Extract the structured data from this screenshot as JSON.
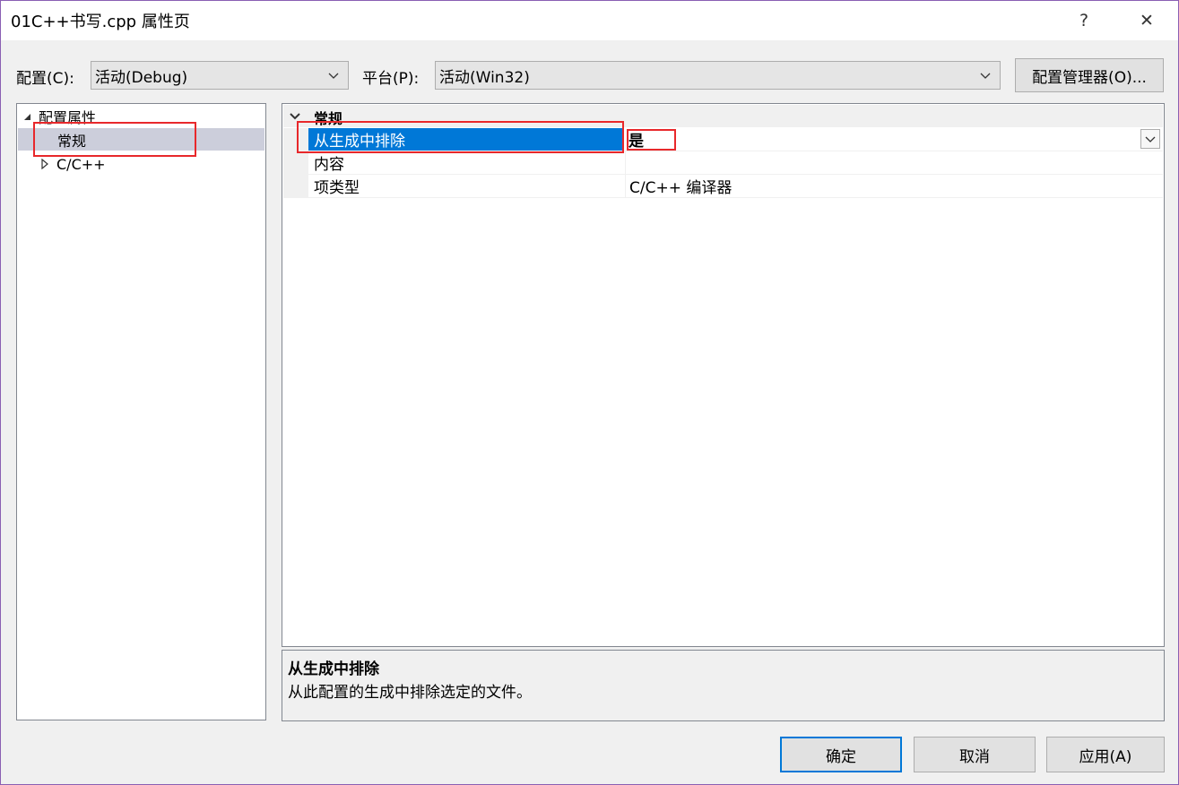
{
  "window": {
    "title": "01C++书写.cpp 属性页",
    "help_glyph": "?",
    "close_glyph": "✕",
    "frame_color": "#8a5fb3"
  },
  "top": {
    "config_label": "配置(C):",
    "config_value": "活动(Debug)",
    "platform_label": "平台(P):",
    "platform_value": "活动(Win32)",
    "config_manager_label": "配置管理器(O)..."
  },
  "tree": {
    "root_label": "配置属性",
    "items": [
      {
        "label": "常规",
        "selected": true
      },
      {
        "label": "C/C++",
        "collapsed": true
      }
    ]
  },
  "grid": {
    "category": "常规",
    "rows": [
      {
        "name": "从生成中排除",
        "value": "是",
        "selected": true,
        "has_dropdown": true
      },
      {
        "name": "内容",
        "value": ""
      },
      {
        "name": "项类型",
        "value": "C/C++ 编译器"
      }
    ]
  },
  "description": {
    "title": "从生成中排除",
    "text": "从此配置的生成中排除选定的文件。"
  },
  "buttons": {
    "ok": "确定",
    "cancel": "取消",
    "apply": "应用(A)"
  },
  "colors": {
    "selection": "#0078d7",
    "tree_selected": "#cccedb",
    "highlight_box": "#e8282b"
  },
  "icons": {
    "tree_expanded": "triangle-down-icon",
    "tree_collapsed": "triangle-right-icon",
    "category_toggle": "chevron-down-icon",
    "combo_arrow": "chevron-down-icon"
  }
}
